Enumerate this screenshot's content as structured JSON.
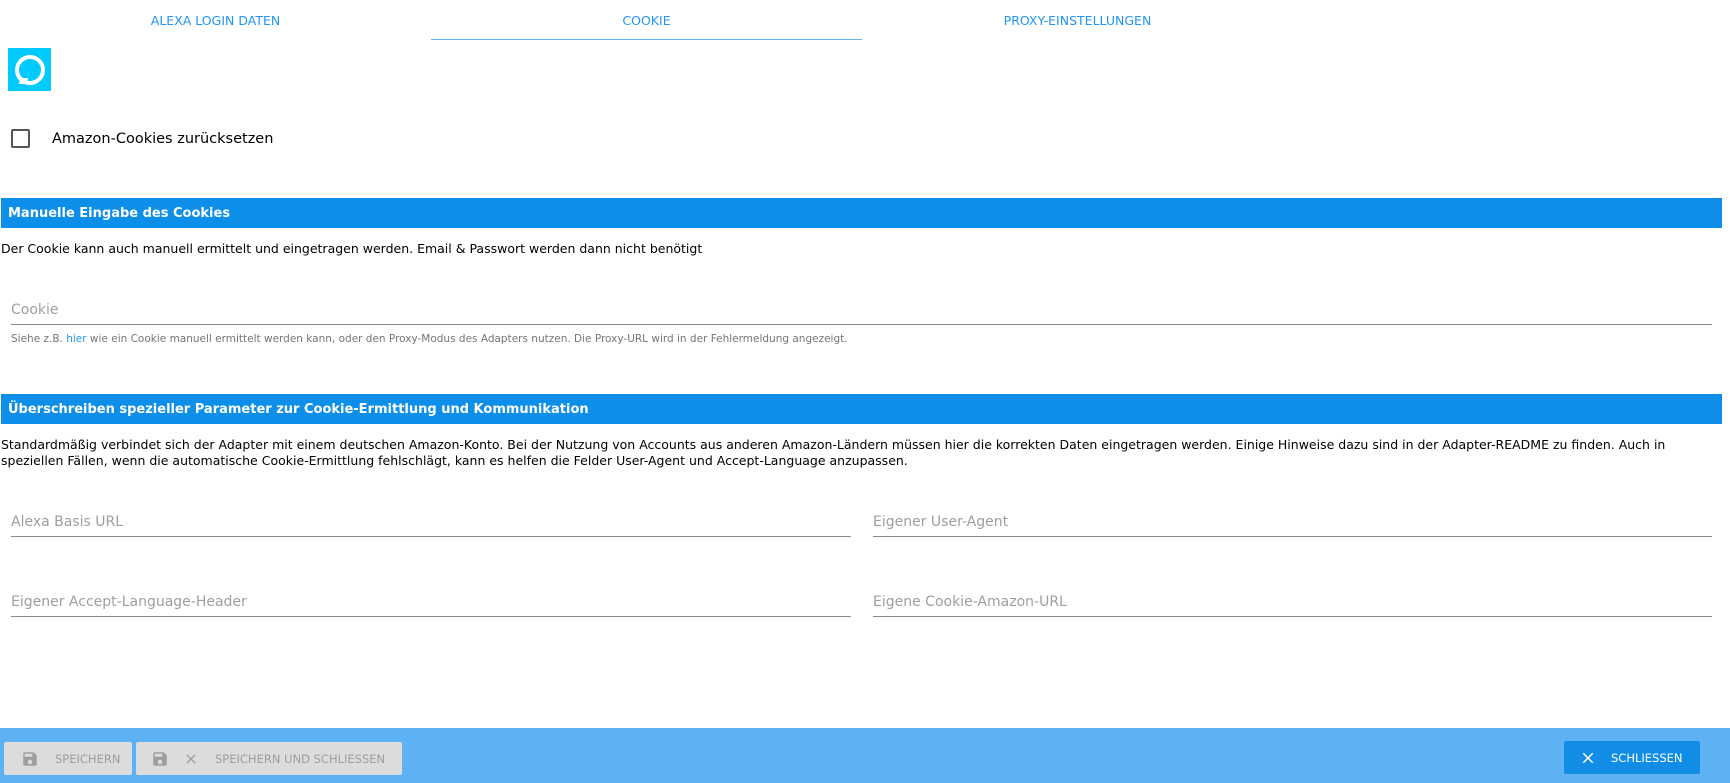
{
  "tabs": [
    {
      "label": "ALEXA LOGIN DATEN"
    },
    {
      "label": "COOKIE"
    },
    {
      "label": "PROXY-EINSTELLUNGEN"
    }
  ],
  "active_tab": "COOKIE",
  "reset_checkbox": {
    "label": "Amazon-Cookies zurücksetzen",
    "checked": false
  },
  "manual_section": {
    "title": "Manuelle Eingabe des Cookies",
    "description": "Der Cookie kann auch manuell ermittelt und eingetragen werden. Email & Passwort werden dann nicht benötigt",
    "cookie_field": {
      "placeholder": "Cookie",
      "value": ""
    },
    "helper_before": "Siehe z.B. ",
    "helper_link": "hier",
    "helper_after": " wie ein Cookie manuell ermittelt werden kann, oder den Proxy-Modus des Adapters nutzen. Die Proxy-URL wird in der Fehlermeldung angezeigt."
  },
  "override_section": {
    "title": "Überschreiben spezieller Parameter zur Cookie-Ermittlung und Kommunikation",
    "description": "Standardmäßig verbindet sich der Adapter mit einem deutschen Amazon-Konto. Bei der Nutzung von Accounts aus anderen Amazon-Ländern müssen hier die korrekten Daten eingetragen werden. Einige Hinweise dazu sind in der Adapter-README zu finden. Auch in speziellen Fällen, wenn die automatische Cookie-Ermittlung fehlschlägt, kann es helfen die Felder User-Agent und Accept-Language anzupassen.",
    "fields": {
      "base_url": {
        "placeholder": "Alexa Basis URL",
        "value": ""
      },
      "user_agent": {
        "placeholder": "Eigener User-Agent",
        "value": ""
      },
      "accept_language": {
        "placeholder": "Eigener Accept-Language-Header",
        "value": ""
      },
      "cookie_amazon_url": {
        "placeholder": "Eigene Cookie-Amazon-URL",
        "value": ""
      }
    }
  },
  "footer": {
    "save_label": "SPEICHERN",
    "save_close_label": "SPEICHERN UND SCHLIESSEN",
    "close_label": "SCHLIESSEN"
  },
  "colors": {
    "accent": "#2196f3",
    "section_header": "#0d8ee9",
    "footer_bg": "#5eb2f3",
    "alexa_logo": "#00caff",
    "close_button": "#118de6"
  },
  "icons": {
    "logo": "alexa-logo-icon",
    "save": "floppy-disk-icon",
    "close": "close-x-icon"
  }
}
